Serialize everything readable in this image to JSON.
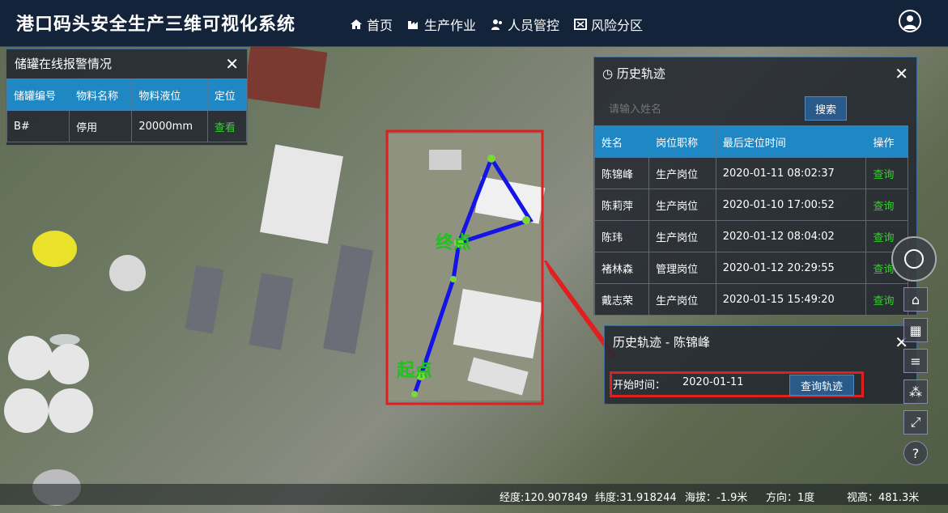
{
  "app_title": "港口码头安全生产三维可视化系统",
  "nav": [
    {
      "label": "首页",
      "icon": "home-icon"
    },
    {
      "label": "生产作业",
      "icon": "factory-icon"
    },
    {
      "label": "人员管控",
      "icon": "users-icon"
    },
    {
      "label": "风险分区",
      "icon": "map-icon"
    }
  ],
  "alarm_panel": {
    "title": "储罐在线报警情况",
    "headers": [
      "储罐编号",
      "物料名称",
      "物料液位",
      "定位"
    ],
    "rows": [
      {
        "id": "B#",
        "name": "停用",
        "level": "20000mm",
        "action": "查看"
      }
    ]
  },
  "track_panel": {
    "title": "历史轨迹",
    "search_placeholder": "请输入姓名",
    "search_button": "搜索",
    "headers": [
      "姓名",
      "岗位职称",
      "最后定位时间",
      "操作"
    ],
    "rows": [
      {
        "name": "陈锦峰",
        "post": "生产岗位",
        "time": "2020-01-11 08:02:37",
        "action": "查询"
      },
      {
        "name": "陈莉萍",
        "post": "生产岗位",
        "time": "2020-01-10 17:00:52",
        "action": "查询"
      },
      {
        "name": "陈玮",
        "post": "生产岗位",
        "time": "2020-01-12 08:04:02",
        "action": "查询"
      },
      {
        "name": "褚林森",
        "post": "管理岗位",
        "time": "2020-01-12 20:29:55",
        "action": "查询"
      },
      {
        "name": "戴志荣",
        "post": "生产岗位",
        "time": "2020-01-15 15:49:20",
        "action": "查询"
      }
    ]
  },
  "detail_panel": {
    "title": "历史轨迹 - 陈锦峰",
    "start_label": "开始时间：",
    "start_value": "2020-01-11",
    "query_button": "查询轨迹"
  },
  "map_labels": {
    "end": "终点",
    "start": "起点"
  },
  "status": {
    "lon": "经度:120.907849",
    "lat": "纬度:31.918244",
    "alt": "海拔：-1.9米",
    "dir": "方向：1度",
    "view": "视高：481.3米"
  },
  "colors": {
    "header": "#13233a",
    "table_header": "#1f87c4",
    "link": "#35d12f",
    "track": "#1414e6",
    "highlight": "#e02020"
  }
}
